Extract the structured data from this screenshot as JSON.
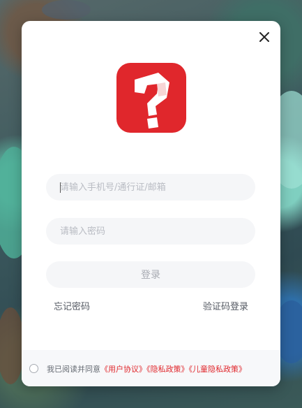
{
  "login": {
    "phone_placeholder": "请输入手机号/通行证/邮箱",
    "password_placeholder": "请输入密码",
    "login_label": "登录",
    "forgot_label": "忘记密码",
    "code_login_label": "验证码登录"
  },
  "agreement": {
    "prefix": "我已阅读并同意",
    "user_agreement": "《用户协议》",
    "privacy_policy": "《隐私政策》",
    "child_privacy_policy": "《儿童隐私政策》"
  },
  "icons": {
    "close": "close-icon",
    "logo": "app-logo-question-mark"
  },
  "colors": {
    "brand_red": "#e0272c",
    "field_bg": "#f5f6f8",
    "placeholder": "#b9bcc3"
  }
}
